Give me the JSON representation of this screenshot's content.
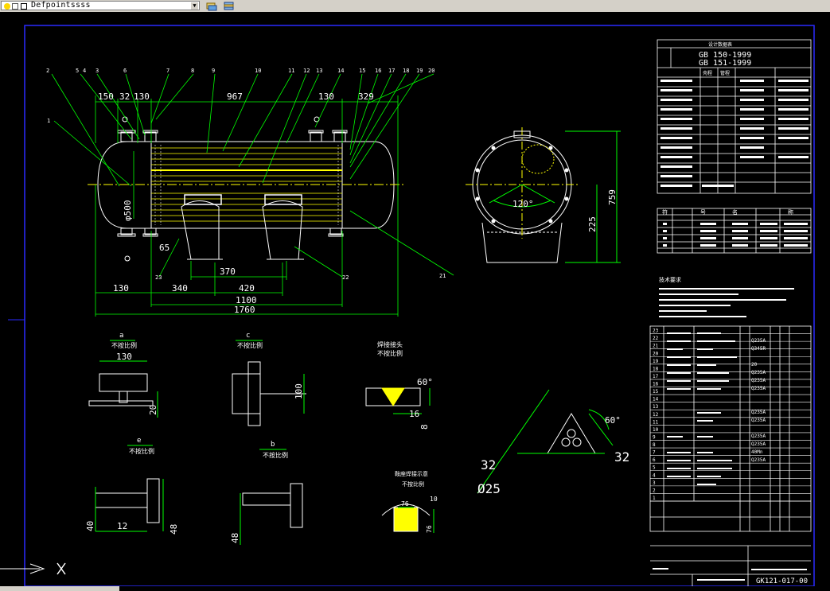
{
  "toolbar": {
    "layer_name": "Defpoints",
    "layer_suffix": "sss",
    "icons": [
      "sun-icon",
      "lock-icon",
      "color-swatch-icon",
      "layer-states-icon",
      "layer-previous-icon"
    ]
  },
  "drawing": {
    "leader_numbers": [
      "1",
      "2",
      "5",
      "4",
      "3",
      "6",
      "7",
      "8",
      "9",
      "10",
      "11",
      "12",
      "13",
      "14",
      "15",
      "16",
      "17",
      "18",
      "19",
      "20",
      "21",
      "22",
      "23"
    ],
    "dims_top": [
      "150",
      "32",
      "130",
      "967",
      "130",
      "329"
    ],
    "dims_bottom": [
      "130",
      "340",
      "420",
      "1100",
      "1760",
      "370"
    ],
    "dim_diameter": "φ500",
    "dim_65": "65",
    "dims_side": [
      "120°",
      "225",
      "759"
    ],
    "detail_a": {
      "title": "a",
      "scale": "不按比例",
      "dims": [
        "130",
        "20"
      ]
    },
    "detail_c": {
      "title": "c",
      "scale": "不按比例",
      "dims": [
        "100"
      ]
    },
    "detail_weld": {
      "title": "焊接接头",
      "scale": "不按比例",
      "dims": [
        "60°",
        "16",
        "8"
      ]
    },
    "detail_e": {
      "title": "e",
      "scale": "不按比例",
      "dims": [
        "40",
        "12",
        "48"
      ]
    },
    "detail_b": {
      "title": "b",
      "scale": "不按比例",
      "dims": [
        "48"
      ]
    },
    "detail_saddle": {
      "title": "鞍座焊接示意",
      "scale": "不按比例",
      "dims": [
        "76",
        "76",
        "10"
      ]
    },
    "tube_layout": {
      "dims": [
        "60°",
        "32",
        "32",
        "Ø25"
      ]
    },
    "spec_table": {
      "title": "设计数据表",
      "standards": [
        "GB 150-1999",
        "GB 151-1999"
      ],
      "col_heads": [
        "壳程",
        "管程"
      ]
    },
    "nozzle_table": {
      "heads": [
        "符",
        "号",
        "名",
        "称"
      ]
    },
    "tech_req_title": "技术要求",
    "bom_rows": [
      "23",
      "22",
      "21",
      "20",
      "19",
      "18",
      "17",
      "16",
      "15",
      "14",
      "13",
      "12",
      "11",
      "10",
      "9",
      "8",
      "7",
      "6",
      "5",
      "4",
      "3",
      "2",
      "1"
    ],
    "bom_labels": [
      "Q235A",
      "Q345R",
      "20",
      "Q235A",
      "Q235A",
      "Q235A",
      "Q235A",
      "Q235A",
      "Q235A",
      "Q235A",
      "Q235A",
      "40Mn"
    ],
    "title_block": {
      "drawing_no": "GK121-017-00"
    }
  },
  "colors": {
    "bg": "#000000",
    "line": "#00ff00",
    "white": "#ffffff",
    "yellow": "#ffff00",
    "frame": "#0000ff",
    "toolbar": "#d4d0c8"
  }
}
